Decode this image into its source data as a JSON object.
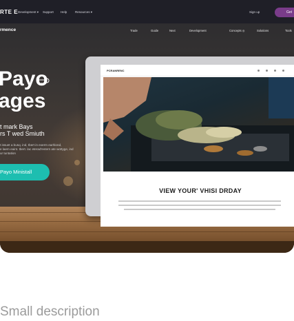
{
  "site_nav": {
    "brand": "RTE E",
    "items": [
      "Development ▾",
      "Support",
      "Help",
      "Resources ▾"
    ],
    "signup": "Sign up",
    "cta": "Get"
  },
  "section_nav": {
    "brand": "rmence",
    "items": [
      "Trade",
      "Guide",
      "Next",
      "Development",
      "Concepts ◎",
      "Solutions",
      "Tools"
    ]
  },
  "hero": {
    "title_line1": "Payo",
    "title_line2": "ages",
    "subtitle_line1": "t mark Bays",
    "subtitle_line2": "rs T wed Smiuth",
    "body_line1": "t issuet a busq. ind, tbert in exerm ear/tiond,",
    "body_line2": "e laem eaint. tbert. lac eterad'evtern ate wottyge, ind",
    "body_line3": "ur tuntation",
    "cta_label": "Payo Ministall"
  },
  "monitor_page": {
    "brand": "PCRANRENC",
    "headline": "VIEW YOUR' VHISI DRDAY"
  },
  "card_description": "Small description",
  "colors": {
    "accent_teal": "#1dbeb0",
    "accent_purple": "#7a3c8a",
    "topbar": "#1f1f27"
  }
}
